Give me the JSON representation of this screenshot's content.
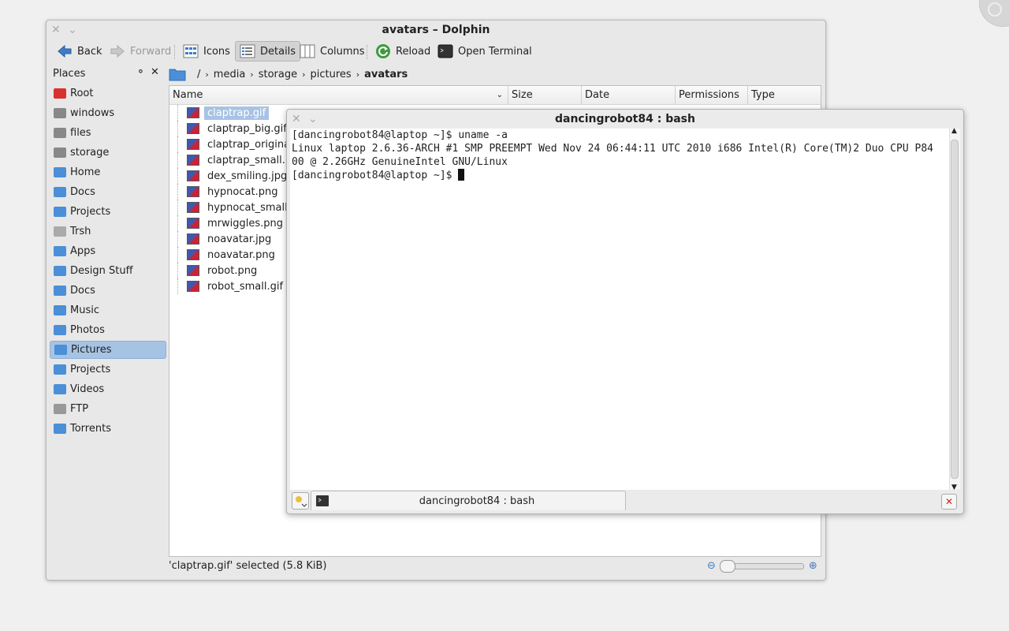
{
  "dolphin": {
    "title": "avatars – Dolphin",
    "toolbar": {
      "back": "Back",
      "forward": "Forward",
      "icons": "Icons",
      "details": "Details",
      "columns": "Columns",
      "reload": "Reload",
      "open_terminal": "Open Terminal"
    },
    "places": {
      "title": "Places",
      "items": [
        {
          "label": "Root",
          "icon": "red-folder-icon"
        },
        {
          "label": "windows",
          "icon": "drive-icon"
        },
        {
          "label": "files",
          "icon": "drive-icon"
        },
        {
          "label": "storage",
          "icon": "drive-icon"
        },
        {
          "label": "Home",
          "icon": "home-folder-icon"
        },
        {
          "label": "Docs",
          "icon": "documents-folder-icon"
        },
        {
          "label": "Projects",
          "icon": "starred-folder-icon"
        },
        {
          "label": "Trsh",
          "icon": "trash-icon"
        },
        {
          "label": "Apps",
          "icon": "folder-icon"
        },
        {
          "label": "Design Stuff",
          "icon": "folder-icon"
        },
        {
          "label": "Docs",
          "icon": "folder-icon"
        },
        {
          "label": "Music",
          "icon": "music-folder-icon"
        },
        {
          "label": "Photos",
          "icon": "photos-folder-icon"
        },
        {
          "label": "Pictures",
          "icon": "folder-icon",
          "selected": true
        },
        {
          "label": "Projects",
          "icon": "starred-folder-icon"
        },
        {
          "label": "Videos",
          "icon": "videos-folder-icon"
        },
        {
          "label": "FTP",
          "icon": "network-drive-icon"
        },
        {
          "label": "Torrents",
          "icon": "folder-icon"
        }
      ]
    },
    "breadcrumb": [
      "/",
      "media",
      "storage",
      "pictures",
      "avatars"
    ],
    "columns": [
      "Name",
      "Size",
      "Date",
      "Permissions",
      "Type"
    ],
    "files": [
      {
        "name": "claptrap.gif",
        "selected": true
      },
      {
        "name": "claptrap_big.gif"
      },
      {
        "name": "claptrap_original.j"
      },
      {
        "name": "claptrap_small.pn"
      },
      {
        "name": "dex_smiling.jpg"
      },
      {
        "name": "hypnocat.png"
      },
      {
        "name": "hypnocat_small.gi"
      },
      {
        "name": "mrwiggles.png"
      },
      {
        "name": "noavatar.jpg"
      },
      {
        "name": "noavatar.png"
      },
      {
        "name": "robot.png"
      },
      {
        "name": "robot_small.gif"
      }
    ],
    "status": "'claptrap.gif' selected (5.8 KiB)"
  },
  "konsole": {
    "title": "dancingrobot84 : bash",
    "lines": [
      "[dancingrobot84@laptop ~]$ uname -a",
      "Linux laptop 2.6.36-ARCH #1 SMP PREEMPT Wed Nov 24 06:44:11 UTC 2010 i686 Intel(R) Core(TM)2 Duo CPU P84",
      "00 @ 2.26GHz GenuineIntel GNU/Linux",
      "[dancingrobot84@laptop ~]$ "
    ],
    "tab_label": "dancingrobot84 : bash"
  },
  "colors": {
    "selection": "#a7c3e4",
    "folder_blue": "#4a8fd8",
    "root_red": "#d93030"
  }
}
